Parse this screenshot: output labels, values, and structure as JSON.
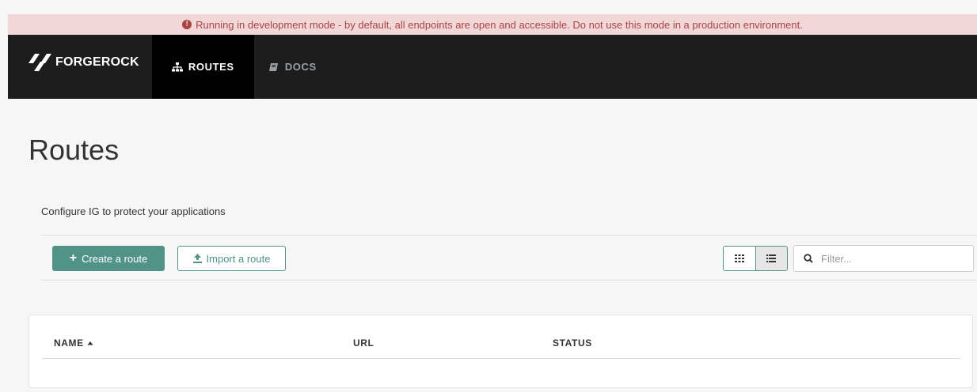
{
  "banner": {
    "message": "Running in development mode - by default, all endpoints are open and accessible. Do not use this mode in a production environment.",
    "icon": "exclamation-circle-icon"
  },
  "nav": {
    "brand": "FORGEROCK",
    "brand_mark": "·",
    "items": [
      {
        "label": "ROUTES",
        "icon": "sitemap-icon",
        "active": true
      },
      {
        "label": "DOCS",
        "icon": "book-icon",
        "active": false
      }
    ]
  },
  "page": {
    "title": "Routes",
    "description": "Configure IG to protect your applications"
  },
  "toolbar": {
    "create_label": "Create a route",
    "import_label": "Import a route",
    "filter_placeholder": "Filter...",
    "view_modes": [
      "grid-icon",
      "list-icon"
    ],
    "active_view": "list"
  },
  "table": {
    "columns": [
      {
        "label": "NAME",
        "sorted": "asc"
      },
      {
        "label": "URL"
      },
      {
        "label": "STATUS"
      }
    ],
    "rows": []
  },
  "colors": {
    "accent": "#519387",
    "banner_bg": "#f2d7d8",
    "banner_text": "#a94442",
    "nav_bg": "#1d1d1d"
  }
}
